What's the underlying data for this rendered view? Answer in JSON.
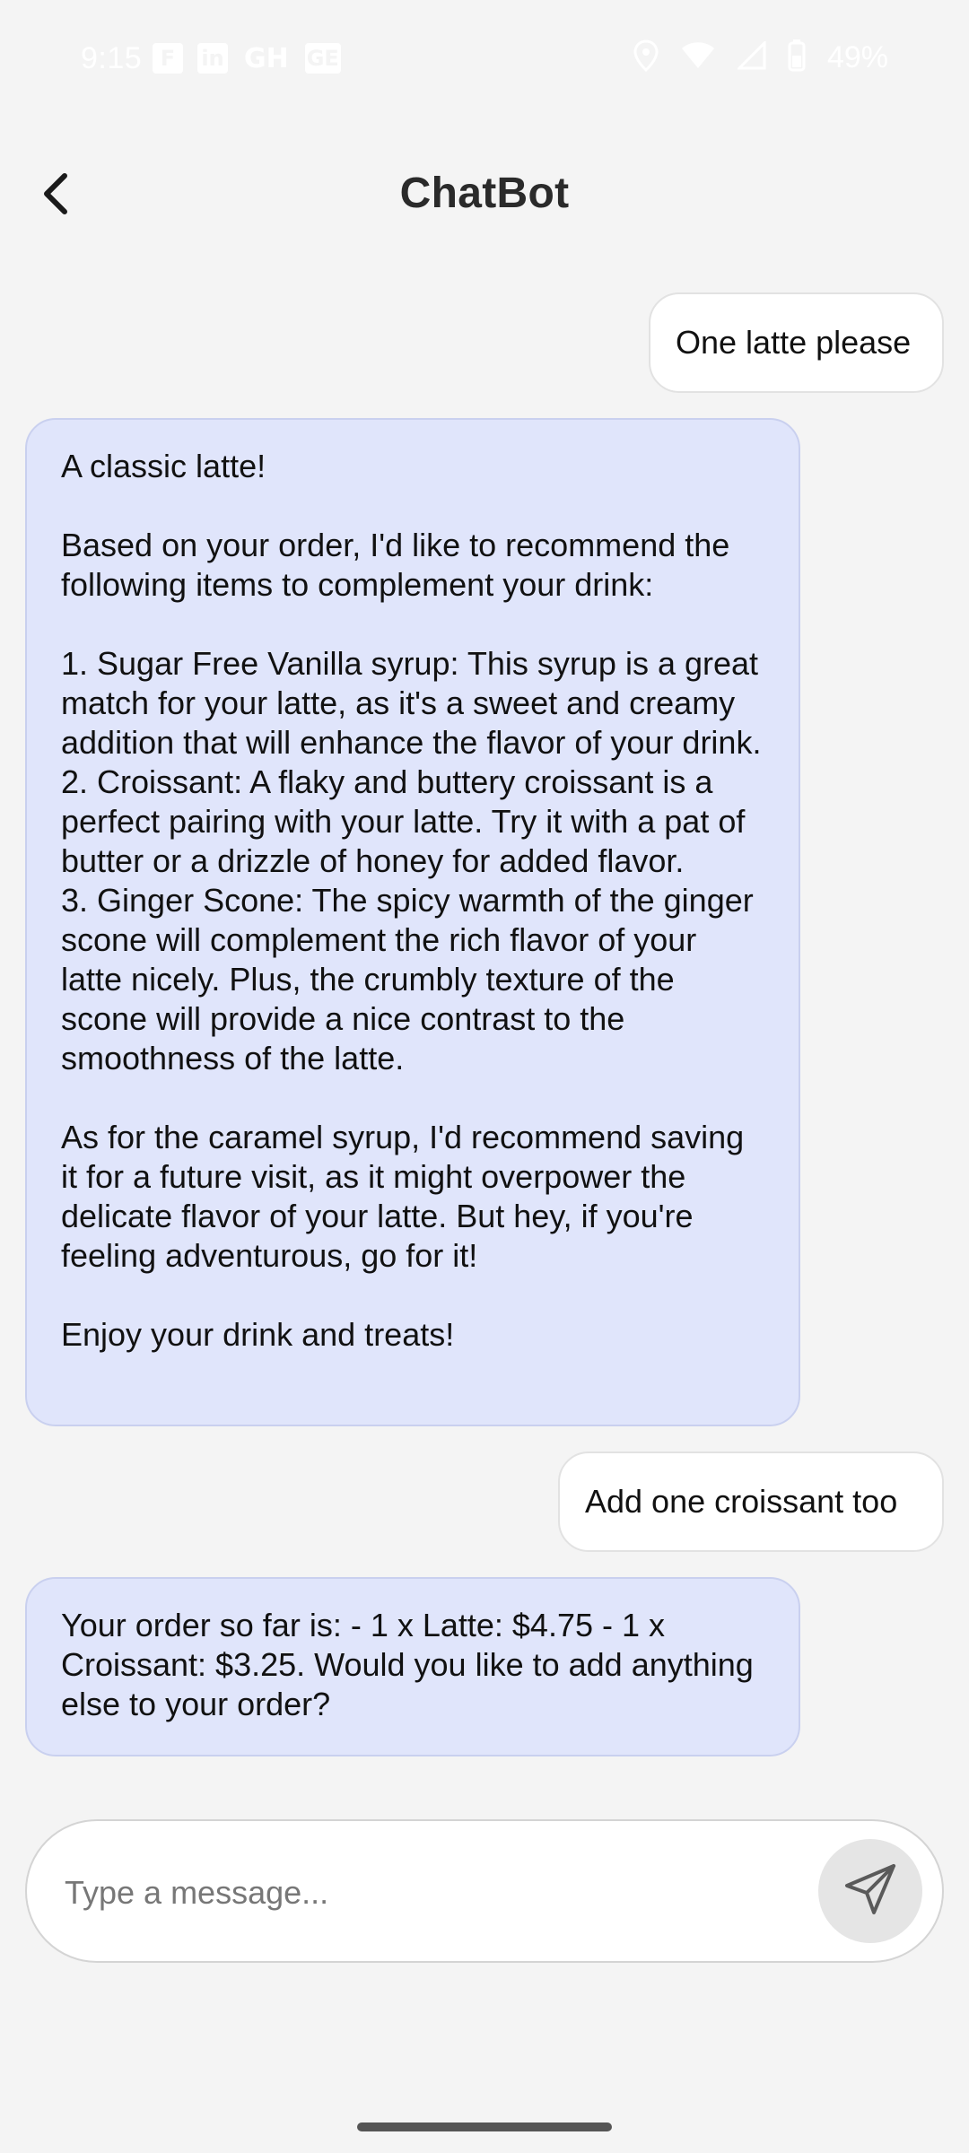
{
  "status_bar": {
    "time": "9:15",
    "notification_icons": [
      "F",
      "in",
      "GH",
      "GE"
    ],
    "battery_percent": "49%"
  },
  "header": {
    "title": "ChatBot",
    "back_icon": "chevron-left-icon"
  },
  "messages": [
    {
      "sender": "user",
      "text": "One latte please"
    },
    {
      "sender": "bot",
      "text": "A classic latte!\n\nBased on your order, I'd like to recommend the following items to complement your drink:\n\n1. Sugar Free Vanilla syrup: This syrup is a great match for your latte, as it's a sweet and creamy addition that will enhance the flavor of your drink.\n2. Croissant: A flaky and buttery croissant is a perfect pairing with your latte. Try it with a pat of butter or a drizzle of honey for added flavor.\n3. Ginger Scone: The spicy warmth of the ginger scone will complement the rich flavor of your latte nicely. Plus, the crumbly texture of the scone will provide a nice contrast to the smoothness of the latte.\n\nAs for the caramel syrup, I'd recommend saving it for a future visit, as it might overpower the delicate flavor of your latte. But hey, if you're feeling adventurous, go for it!\n\nEnjoy your drink and treats!"
    },
    {
      "sender": "user",
      "text": "Add one croissant too"
    },
    {
      "sender": "bot",
      "text": "Your order so far is: - 1 x Latte: $4.75 - 1 x Croissant: $3.25. Would you like to add anything else to your order?"
    }
  ],
  "composer": {
    "placeholder": "Type a message...",
    "value": "",
    "send_icon": "send-icon"
  },
  "colors": {
    "background": "#f4f4f4",
    "user_bubble": "#ffffff",
    "bot_bubble": "#e0e5fb",
    "bot_bubble_border": "#c9d0ef",
    "send_button": "#e5e5e5"
  }
}
